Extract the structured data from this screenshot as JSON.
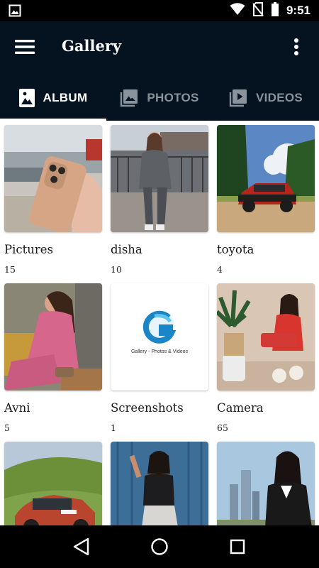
{
  "status_bar": {
    "time": "9:51",
    "icons": [
      "image-notification-icon",
      "wifi-icon",
      "no-sim-icon",
      "battery-icon"
    ]
  },
  "app_bar": {
    "title": "Gallery",
    "menu_icon": "hamburger-menu-icon",
    "more_icon": "more-vertical-icon"
  },
  "tabs": [
    {
      "label": "ALBUM",
      "icon": "album-icon",
      "active": true
    },
    {
      "label": "PHOTOS",
      "icon": "photos-icon",
      "active": false
    },
    {
      "label": "VIDEOS",
      "icon": "videos-icon",
      "active": false
    }
  ],
  "albums": [
    {
      "name": "Pictures",
      "count": "15"
    },
    {
      "name": "disha",
      "count": "10"
    },
    {
      "name": "toyota",
      "count": "4"
    },
    {
      "name": "Avni",
      "count": "5"
    },
    {
      "name": "Screenshots",
      "count": "1",
      "thumb_caption": "Gallery - Photos & Videos"
    },
    {
      "name": "Camera",
      "count": "65"
    },
    {
      "name": "",
      "count": ""
    },
    {
      "name": "",
      "count": ""
    },
    {
      "name": "",
      "count": ""
    }
  ],
  "nav_bar": {
    "icons": [
      "back-icon",
      "home-icon",
      "recents-icon"
    ]
  },
  "colors": {
    "app_bar": "#051321",
    "status_bar": "#000000",
    "tab_active": "#ffffff",
    "tab_inactive": "#8a929b"
  }
}
